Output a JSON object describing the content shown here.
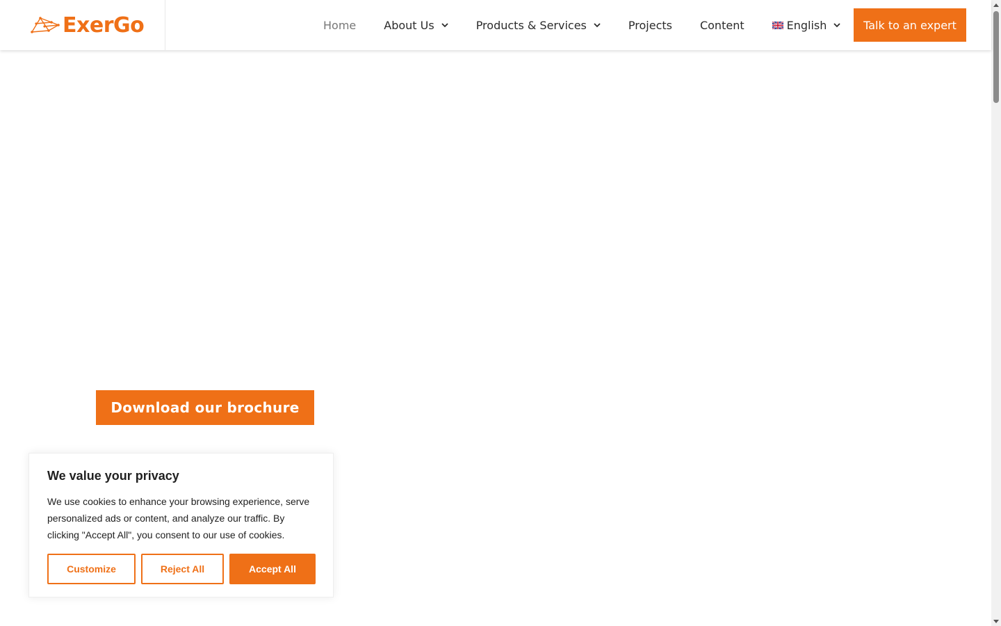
{
  "brand": {
    "logo_text": "ExerGo",
    "accent_color": "#ef7017"
  },
  "nav": {
    "items": [
      {
        "label": "Home",
        "active": true,
        "dropdown": false
      },
      {
        "label": "About Us",
        "dropdown": true
      },
      {
        "label": "Products & Services",
        "dropdown": true
      },
      {
        "label": "Projects",
        "dropdown": false
      },
      {
        "label": "Content",
        "dropdown": false
      }
    ],
    "language": {
      "label": "English",
      "flag_icon": "uk-flag-icon"
    },
    "cta_label": "Talk to an expert"
  },
  "hero": {
    "brochure_label": "Download our brochure"
  },
  "cookie_banner": {
    "title": "We value your privacy",
    "text": "We use cookies to enhance your browsing experience, serve personalized ads or content, and analyze our traffic. By clicking \"Accept All\", you consent to our use of cookies.",
    "customize_label": "Customize",
    "reject_label": "Reject All",
    "accept_label": "Accept All"
  }
}
